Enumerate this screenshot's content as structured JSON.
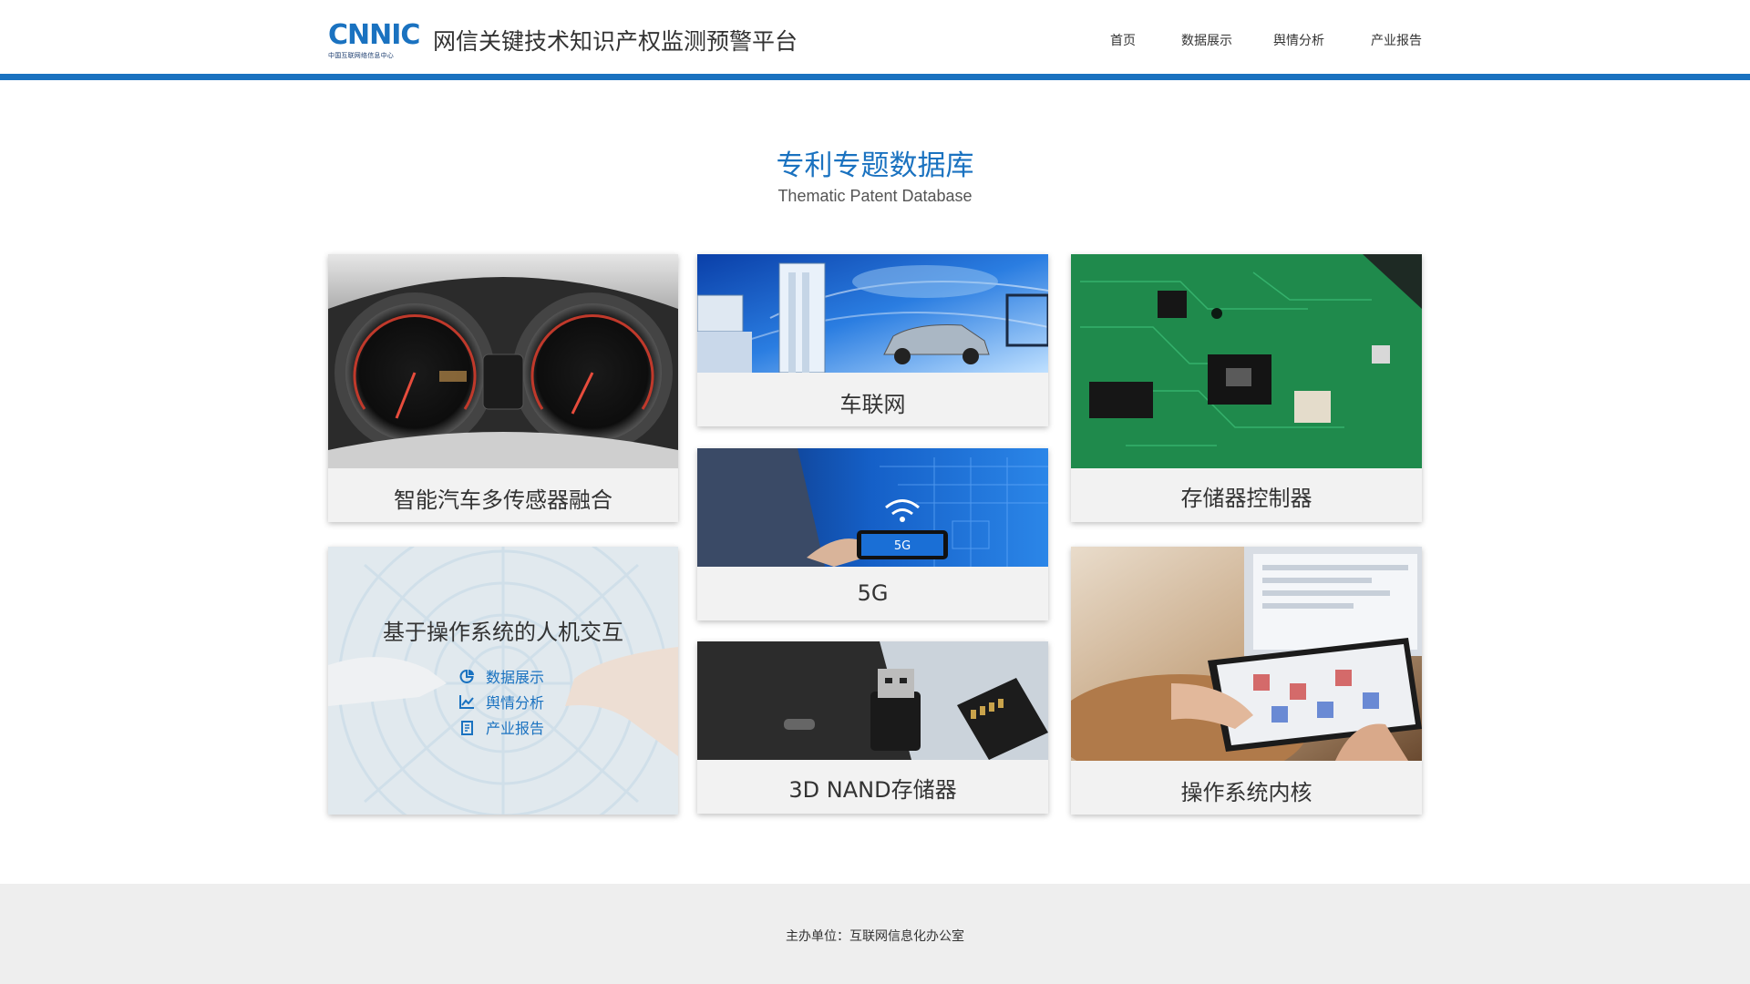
{
  "header": {
    "logo_text": "CNNIC",
    "logo_sub": "中国互联网络信息中心",
    "site_title": "网信关键技术知识产权监测预警平台",
    "nav": [
      "首页",
      "数据展示",
      "舆情分析",
      "产业报告"
    ]
  },
  "section": {
    "title": "专利专题数据库",
    "subtitle": "Thematic Patent Database"
  },
  "cards": {
    "car_sensors": "智能汽车多传感器融合",
    "iov": "车联网",
    "storage_ctrl": "存储器控制器",
    "g5": "5G",
    "nand": "3D NAND存储器",
    "os_kernel": "操作系统内核",
    "hci": {
      "title": "基于操作系统的人机交互",
      "links": [
        "数据展示",
        "舆情分析",
        "产业报告"
      ]
    }
  },
  "img_text": {
    "screen_5g": "5G"
  },
  "footer": {
    "text": "主办单位：互联网信息化办公室"
  },
  "colors": {
    "brand": "#1a72c0",
    "card_bg": "#f2f2f2",
    "footer_bg": "#eeeeee"
  }
}
